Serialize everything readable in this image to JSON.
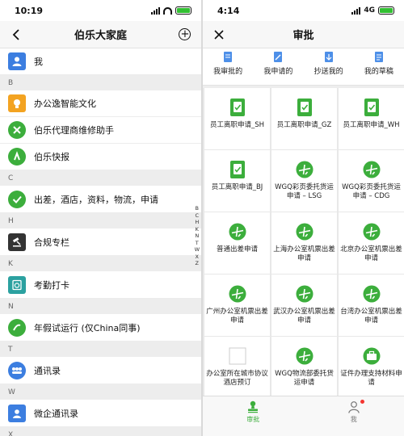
{
  "left": {
    "status": {
      "time": "10:19"
    },
    "nav": {
      "title": "伯乐大家庭"
    },
    "me_row": {
      "label": "我"
    },
    "sections": {
      "b": "B",
      "c": "C",
      "h": "H",
      "k": "K",
      "n": "N",
      "t": "T",
      "w": "W",
      "x": "X"
    },
    "contacts": [
      {
        "name": "办公逸智能文化"
      },
      {
        "name": "伯乐代理商维修助手"
      },
      {
        "name": "伯乐快报"
      },
      {
        "name": "出差，酒店，资料，物流，申请"
      },
      {
        "name": "合规专栏"
      },
      {
        "name": "考勤打卡"
      },
      {
        "name": "年假试运行 (仅China同事)"
      },
      {
        "name": "通讯录"
      },
      {
        "name": "微企通讯录"
      }
    ],
    "index_letters": [
      "B",
      "C",
      "H",
      "K",
      "N",
      "T",
      "W",
      "X",
      "Z"
    ]
  },
  "right": {
    "status": {
      "time": "4:14",
      "network": "4G"
    },
    "nav": {
      "title": "审批"
    },
    "quick": [
      {
        "label": "我审批的"
      },
      {
        "label": "我申请的"
      },
      {
        "label": "抄送我的"
      },
      {
        "label": "我的草稿"
      }
    ],
    "grid": [
      {
        "label": "员工离职申请_SH",
        "icon": "form-icon"
      },
      {
        "label": "员工离职申请_GZ",
        "icon": "form-icon"
      },
      {
        "label": "员工离职申请_WH",
        "icon": "form-icon"
      },
      {
        "label": "员工离职申请_BJ",
        "icon": "form-icon"
      },
      {
        "label": "WGQ彩页委托货运申请 – LSG",
        "icon": "plane-icon"
      },
      {
        "label": "WGQ彩页委托货运申请 – CDG",
        "icon": "plane-icon"
      },
      {
        "label": "普通出差申请",
        "icon": "plane-icon"
      },
      {
        "label": "上海办公室机票出差申请",
        "icon": "plane-icon"
      },
      {
        "label": "北京办公室机票出差申请",
        "icon": "plane-icon"
      },
      {
        "label": "广州办公室机票出差申请",
        "icon": "plane-icon"
      },
      {
        "label": "武汉办公室机票出差申请",
        "icon": "plane-icon"
      },
      {
        "label": "台湾办公室机票出差申请",
        "icon": "plane-icon"
      },
      {
        "label": "办公室所在城市协议酒店预订",
        "icon": "blank-icon"
      },
      {
        "label": "WGQ物流部委托货运申请",
        "icon": "plane-icon"
      },
      {
        "label": "证件办理支持材料申请",
        "icon": "bag-icon"
      }
    ],
    "tabs": {
      "approval": "审批",
      "me": "我"
    }
  },
  "colors": {
    "green": "#3cae3c",
    "blue_avatar": "#3c7ee0",
    "orange_avatar": "#f3a321",
    "teal_avatar": "#2ba1a0",
    "dark_avatar": "#333333",
    "red_dot": "#f43530"
  }
}
